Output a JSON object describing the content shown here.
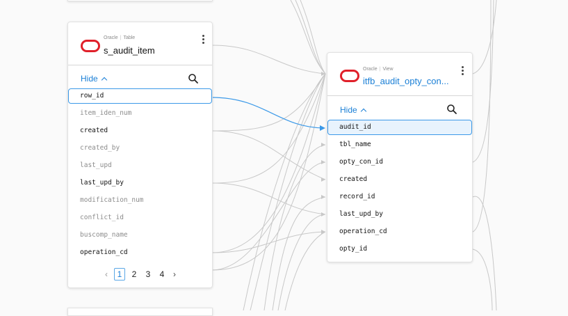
{
  "left_table": {
    "source": "Oracle",
    "kind": "Table",
    "name": "s_audit_item",
    "hide_label": "Hide",
    "columns": [
      {
        "name": "row_id",
        "muted": false,
        "selected": true
      },
      {
        "name": "item_iden_num",
        "muted": true
      },
      {
        "name": "created",
        "muted": false
      },
      {
        "name": "created_by",
        "muted": true
      },
      {
        "name": "last_upd",
        "muted": true
      },
      {
        "name": "last_upd_by",
        "muted": false
      },
      {
        "name": "modification_num",
        "muted": true
      },
      {
        "name": "conflict_id",
        "muted": true
      },
      {
        "name": "buscomp_name",
        "muted": true
      },
      {
        "name": "operation_cd",
        "muted": false
      }
    ],
    "pagination": {
      "prev": "‹",
      "pages": [
        "1",
        "2",
        "3",
        "4"
      ],
      "current": "1",
      "next": "›"
    }
  },
  "right_table": {
    "source": "Oracle",
    "kind": "View",
    "name": "itfb_audit_opty_con...",
    "hide_label": "Hide",
    "columns": [
      {
        "name": "audit_id",
        "selected": true
      },
      {
        "name": "tbl_name"
      },
      {
        "name": "opty_con_id"
      },
      {
        "name": "created"
      },
      {
        "name": "record_id"
      },
      {
        "name": "last_upd_by"
      },
      {
        "name": "operation_cd"
      },
      {
        "name": "opty_id"
      }
    ]
  },
  "colors": {
    "accent": "#1a7fd6",
    "oracle_red": "#e0202a",
    "edge": "#c8c8c8",
    "active_edge": "#3b99e8"
  }
}
